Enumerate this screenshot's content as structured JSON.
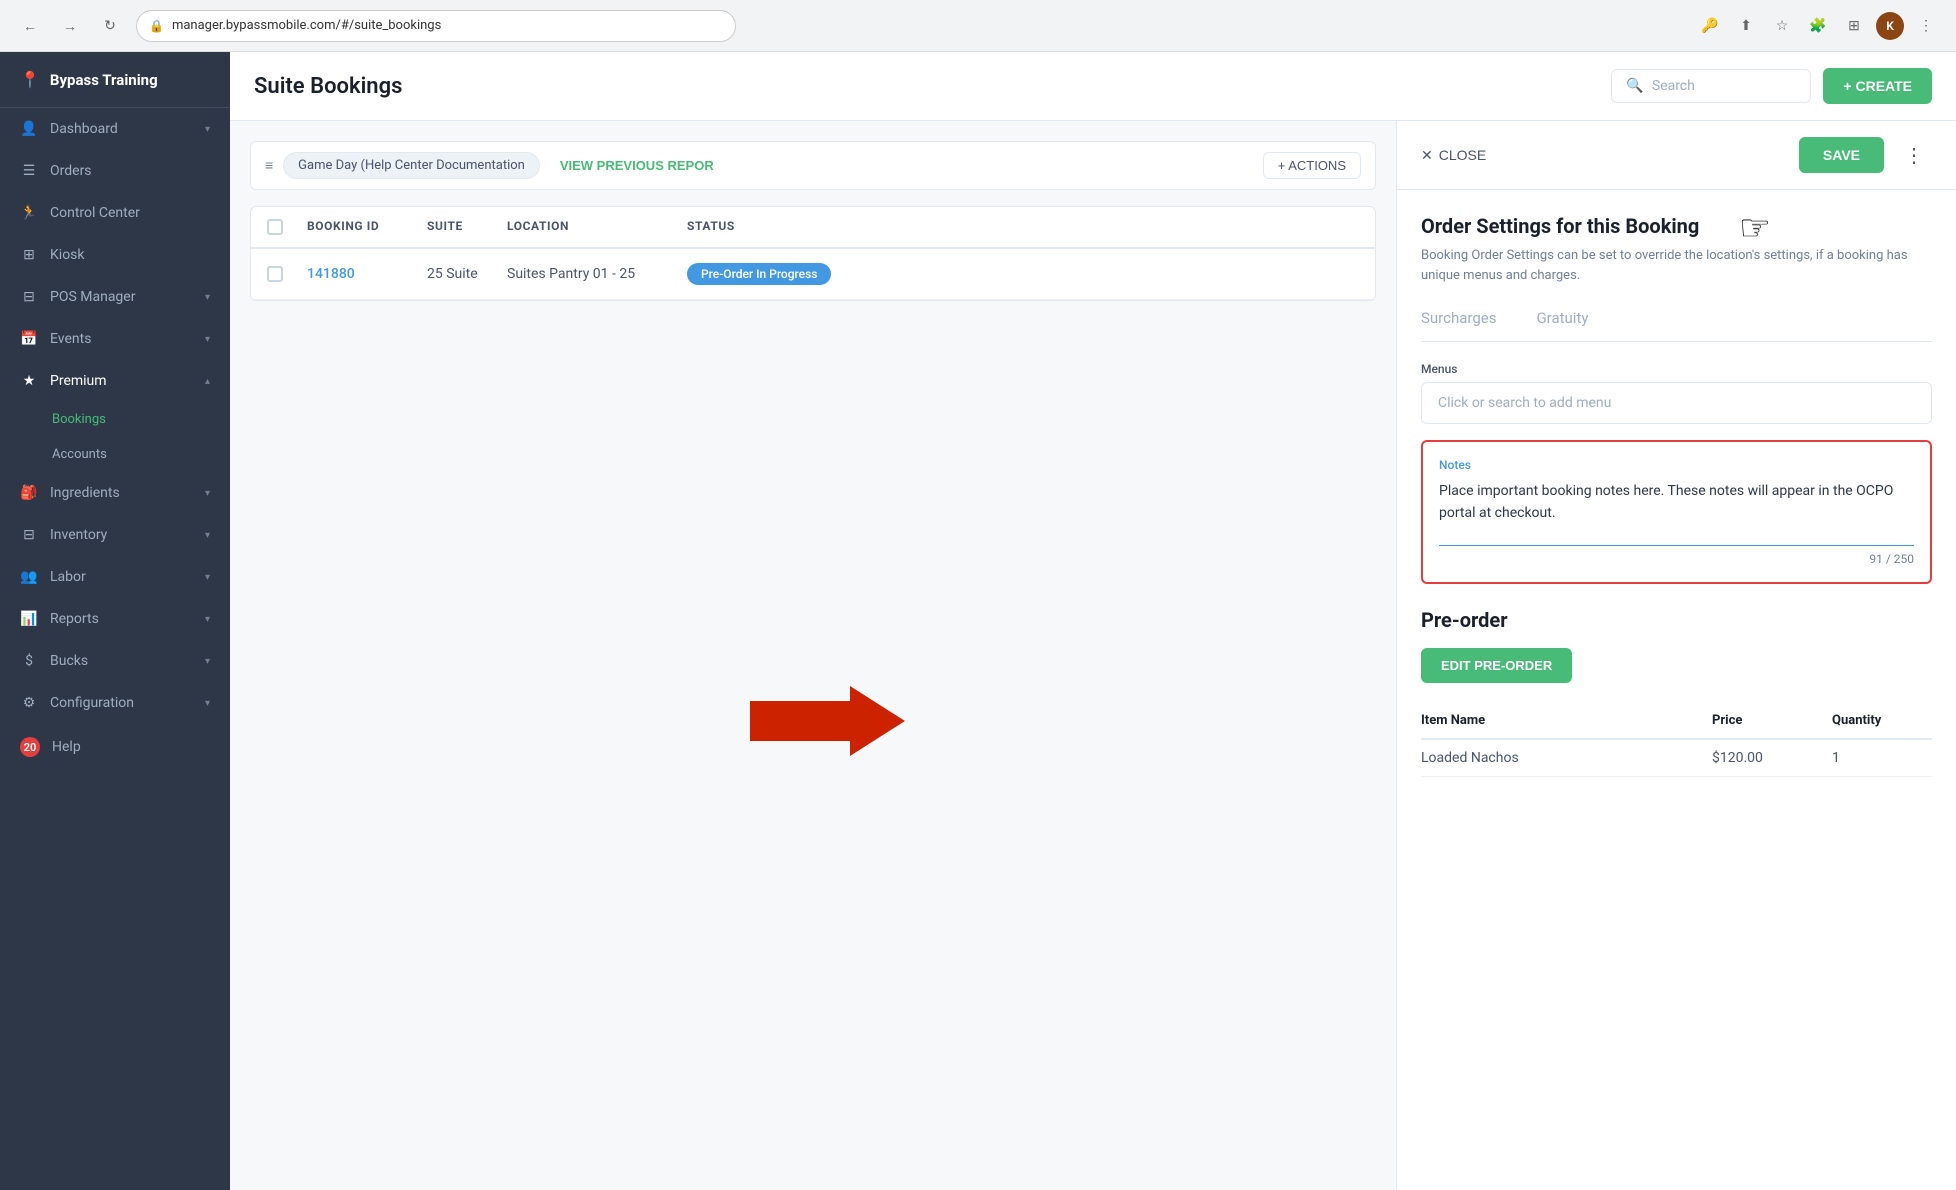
{
  "browser": {
    "url": "manager.bypassmobile.com/#/suite_bookings",
    "back": "←",
    "forward": "→",
    "refresh": "↺"
  },
  "sidebar": {
    "logo": "Bypass Training",
    "logo_icon": "📍",
    "items": [
      {
        "label": "Dashboard",
        "icon": "👤",
        "hasChevron": true,
        "id": "dashboard"
      },
      {
        "label": "Orders",
        "icon": "☰",
        "hasChevron": false,
        "id": "orders"
      },
      {
        "label": "Control Center",
        "icon": "🏃",
        "hasChevron": false,
        "id": "control-center"
      },
      {
        "label": "Kiosk",
        "icon": "⊞",
        "hasChevron": false,
        "id": "kiosk"
      },
      {
        "label": "POS Manager",
        "icon": "⊟",
        "hasChevron": true,
        "id": "pos-manager"
      },
      {
        "label": "Events",
        "icon": "📅",
        "hasChevron": true,
        "id": "events"
      },
      {
        "label": "Premium",
        "icon": "★",
        "hasChevron": true,
        "id": "premium",
        "expanded": true
      },
      {
        "label": "Bookings",
        "isSubItem": true,
        "active": true,
        "id": "bookings"
      },
      {
        "label": "Accounts",
        "isSubItem": true,
        "id": "accounts"
      },
      {
        "label": "Ingredients",
        "icon": "🎒",
        "hasChevron": true,
        "id": "ingredients"
      },
      {
        "label": "Inventory",
        "icon": "⊟",
        "hasChevron": true,
        "id": "inventory"
      },
      {
        "label": "Labor",
        "icon": "👥",
        "hasChevron": true,
        "id": "labor"
      },
      {
        "label": "Reports",
        "icon": "📊",
        "hasChevron": true,
        "id": "reports"
      },
      {
        "label": "Bucks",
        "icon": "$",
        "hasChevron": true,
        "id": "bucks"
      },
      {
        "label": "Configuration",
        "icon": "⚙",
        "hasChevron": true,
        "id": "configuration"
      },
      {
        "label": "Help",
        "icon": "?",
        "id": "help",
        "badge": "20"
      }
    ]
  },
  "header": {
    "title": "Suite Bookings",
    "search_placeholder": "Search",
    "create_label": "+ CREATE"
  },
  "filter_bar": {
    "tag": "Game Day (Help Center Documentation",
    "view_prev": "VIEW PREVIOUS REPOR",
    "actions": "+ ACTIONS"
  },
  "table": {
    "columns": [
      "",
      "BOOKING ID",
      "SUITE",
      "LOCATION",
      "STATUS"
    ],
    "rows": [
      {
        "id": "141880",
        "suite": "25 Suite",
        "location": "Suites Pantry 01 - 25",
        "status": "Pre-Order In Progress"
      }
    ]
  },
  "panel": {
    "close_label": "CLOSE",
    "save_label": "SAVE",
    "title": "Order Settings for this Booking",
    "description": "Booking Order Settings can be set to override the location's settings, if a booking has unique menus and charges.",
    "tabs": [
      {
        "label": "Surcharges",
        "active": false
      },
      {
        "label": "Gratuity",
        "active": false
      }
    ],
    "menus_label": "Menus",
    "menus_placeholder": "Click or search to add menu",
    "notes_label": "Notes",
    "notes_content": "Place important booking notes here. These notes will appear in the OCPO portal at checkout.",
    "notes_char_count": "91 / 250",
    "preorder": {
      "title": "Pre-order",
      "edit_label": "EDIT PRE-ORDER",
      "columns": [
        "Item Name",
        "Price",
        "Quantity"
      ],
      "rows": [
        {
          "name": "Loaded Nachos",
          "price": "$120.00",
          "quantity": "1"
        }
      ]
    }
  },
  "arrow": "→"
}
